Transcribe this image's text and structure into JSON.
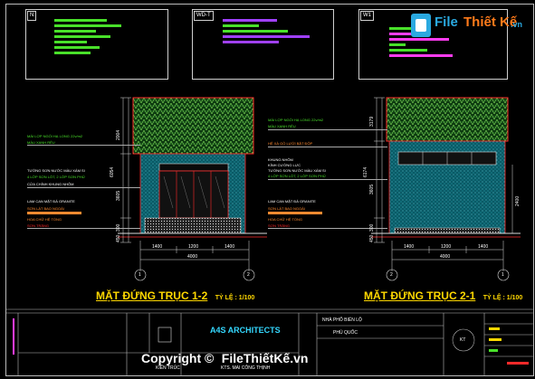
{
  "header_tags": {
    "left": "N",
    "mid": "WD-T",
    "right": "W1"
  },
  "colors": {
    "green": "#49e12a",
    "magenta": "#ff3cf0",
    "violet": "#a040ff",
    "orange": "#ff8a30",
    "red": "#ff2a2a",
    "yellow": "#ffd800",
    "cyan": "#34d8ff"
  },
  "left_elevation": {
    "title": "MẶT ĐỨNG TRỤC 1-2",
    "scale": "TỶ LỆ : 1/100",
    "notes": [
      "MÁI LỢP NGÓI HẠ LONG 22v/m2",
      "MÀU XANH RÊU",
      "TƯỜNG SƠN NƯỚC MÀU XÁM SI",
      "4 LỚP SƠN LÓT, 2 LỚP SƠN PHỦ",
      "CỬA CHÍNH KHUNG NHÔM",
      "LAM CAN MẶT ĐÁ GRANITE",
      "SƠN LÁT BAO NGOÀI",
      "HOA CHỮ HỆ TỔNG",
      "SƠN TRẮNG"
    ],
    "dims_bottom": [
      "1400",
      "1200",
      "1400"
    ],
    "dim_total": "4000",
    "axis": [
      "1",
      "2"
    ],
    "dims_left": [
      "2004",
      "3605",
      "6054",
      "300",
      "450"
    ]
  },
  "right_elevation": {
    "title": "MẶT ĐỨNG TRỤC 2-1",
    "scale": "TỶ LỆ : 1/100",
    "notes": [
      "MÁI LỢP NGÓI HẠ LONG 22v/m2",
      "MÀU XANH RÊU",
      "HỆ XÀ GỒ LƯỚI BẮT ĐỘP",
      "KHUNG NHÔM",
      "KÍNH CƯỜNG LỰC",
      "TƯỜNG SƠN NƯỚC MÀU XÁM SI",
      "4 LỚP SƠN LÓT, 2 LỚP SƠN PHỦ",
      "LAM CAN MẶT ĐÁ GRANITE",
      "SƠN LÁT BAO NGOÀI",
      "HOA CHỮ HỆ TỔNG",
      "SƠN TRẮNG"
    ],
    "dims_bottom": [
      "1400",
      "1200",
      "1400"
    ],
    "dim_total": "4000",
    "axis": [
      "2",
      "1"
    ],
    "dims_left": [
      "3179",
      "3605",
      "6174",
      "300",
      "450"
    ],
    "dim_right": "2400"
  },
  "title_block": {
    "firm": "A4S ARCHITECTS",
    "project": "NHÀ PHỐ BIỂN LỘ",
    "location": "PHÚ QUỐC",
    "stamp": "KT",
    "architect_label": "KTS. MAI CÔNG THỊNH",
    "sign_label": "KIẾN TRÚC"
  },
  "watermark": {
    "brand_top": "File",
    "brand_mid": "Thiết Kế",
    "brand_tld": ".vn",
    "footer_copyright": "Copyright ©",
    "footer_brand": "FileThiếtKế.vn"
  }
}
